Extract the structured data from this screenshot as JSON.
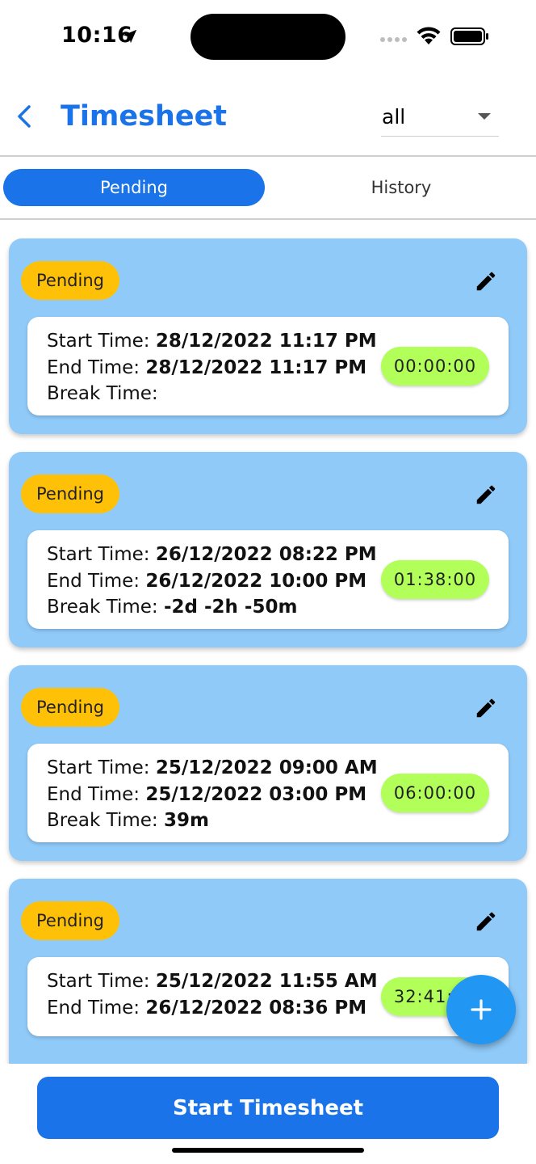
{
  "status_bar": {
    "time": "10:16"
  },
  "header": {
    "title": "Timesheet",
    "filter_value": "all"
  },
  "tabs": [
    {
      "label": "Pending"
    },
    {
      "label": "History"
    }
  ],
  "cards": [
    {
      "status": "Pending",
      "start_label": "Start Time: ",
      "start": "28/12/2022 11:17 PM",
      "end_label": "End Time: ",
      "end": "28/12/2022 11:17 PM",
      "break_label": "Break Time: ",
      "break": "",
      "duration": "00:00:00"
    },
    {
      "status": "Pending",
      "start_label": "Start Time: ",
      "start": "26/12/2022 08:22 PM",
      "end_label": "End Time: ",
      "end": "26/12/2022 10:00 PM",
      "break_label": "Break Time: ",
      "break": "-2d -2h -50m",
      "duration": "01:38:00"
    },
    {
      "status": "Pending",
      "start_label": "Start Time: ",
      "start": "25/12/2022 09:00 AM",
      "end_label": "End Time: ",
      "end": "25/12/2022 03:00 PM",
      "break_label": "Break Time: ",
      "break": "39m",
      "duration": "06:00:00"
    },
    {
      "status": "Pending",
      "start_label": "Start Time: ",
      "start": "25/12/2022 11:55 AM",
      "end_label": "End Time: ",
      "end": "26/12/2022 08:36 PM",
      "break_label": "",
      "break": "",
      "duration": "32:41:00"
    }
  ],
  "bottom": {
    "start_button": "Start Timesheet"
  },
  "colors": {
    "primary": "#1a73e8",
    "card_bg": "#90caf9",
    "pending_badge": "#ffc107",
    "duration_badge": "#b2ff59",
    "fab": "#2196f3"
  }
}
